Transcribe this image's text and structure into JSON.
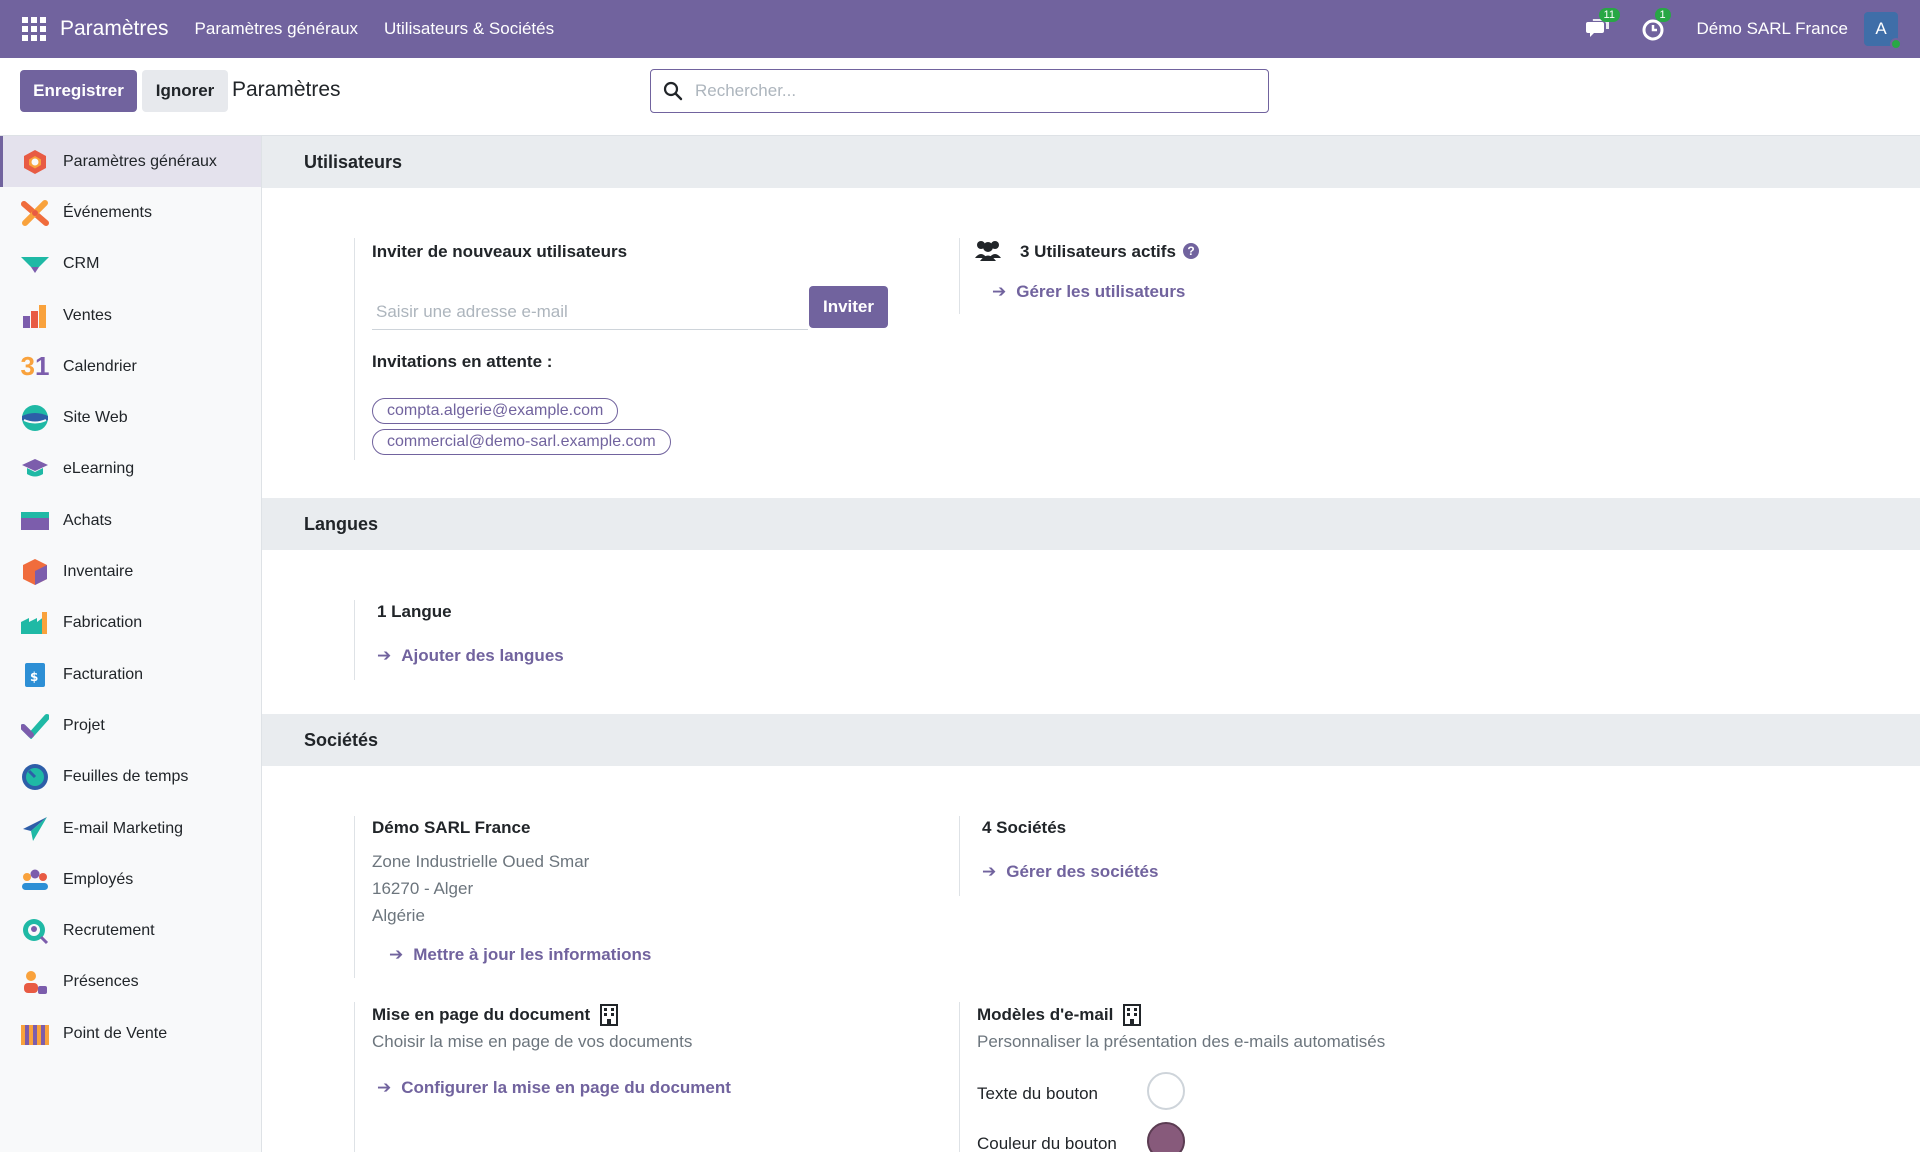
{
  "topbar": {
    "brand": "Paramètres",
    "menu": [
      "Paramètres généraux",
      "Utilisateurs & Sociétés"
    ],
    "messages_count": "11",
    "activities_count": "1",
    "company": "Démo SARL France",
    "avatar_letter": "A"
  },
  "control": {
    "save_label": "Enregistrer",
    "discard_label": "Ignorer",
    "title": "Paramètres",
    "search_placeholder": "Rechercher..."
  },
  "sidebar": {
    "items": [
      {
        "label": "Paramètres généraux",
        "icon": "settings-app-icon",
        "active": true
      },
      {
        "label": "Événements",
        "icon": "events-app-icon"
      },
      {
        "label": "CRM",
        "icon": "crm-app-icon"
      },
      {
        "label": "Ventes",
        "icon": "sales-app-icon"
      },
      {
        "label": "Calendrier",
        "icon": "calendar-app-icon"
      },
      {
        "label": "Site Web",
        "icon": "website-app-icon"
      },
      {
        "label": "eLearning",
        "icon": "elearning-app-icon"
      },
      {
        "label": "Achats",
        "icon": "purchase-app-icon"
      },
      {
        "label": "Inventaire",
        "icon": "inventory-app-icon"
      },
      {
        "label": "Fabrication",
        "icon": "manufacturing-app-icon"
      },
      {
        "label": "Facturation",
        "icon": "invoicing-app-icon"
      },
      {
        "label": "Projet",
        "icon": "project-app-icon"
      },
      {
        "label": "Feuilles de temps",
        "icon": "timesheets-app-icon"
      },
      {
        "label": "E-mail Marketing",
        "icon": "email-marketing-app-icon"
      },
      {
        "label": "Employés",
        "icon": "employees-app-icon"
      },
      {
        "label": "Recrutement",
        "icon": "recruitment-app-icon"
      },
      {
        "label": "Présences",
        "icon": "attendances-app-icon"
      },
      {
        "label": "Point de Vente",
        "icon": "pos-app-icon"
      }
    ]
  },
  "users": {
    "section_title": "Utilisateurs",
    "invite_title": "Inviter de nouveaux utilisateurs",
    "email_placeholder": "Saisir une adresse e-mail",
    "invite_button": "Inviter",
    "pending_title": "Invitations en attente :",
    "pending": [
      "compta.algerie@example.com",
      "commercial@demo-sarl.example.com"
    ],
    "active_users": "3 Utilisateurs actifs",
    "manage_users": "Gérer les utilisateurs"
  },
  "languages": {
    "section_title": "Langues",
    "count": "1 Langue",
    "add_link": "Ajouter des langues"
  },
  "companies": {
    "section_title": "Sociétés",
    "company_name": "Démo SARL France",
    "address_line1": "Zone Industrielle Oued Smar",
    "address_line2": "16270 - Alger",
    "address_line3": "Algérie",
    "update_link": "Mettre à jour les informations",
    "count": "4 Sociétés",
    "manage_link": "Gérer des sociétés",
    "layout_title": "Mise en page du document",
    "layout_desc": "Choisir la mise en page de vos documents",
    "layout_link": "Configurer la mise en page du document",
    "email_templates_title": "Modèles d'e-mail",
    "email_templates_desc": "Personnaliser la présentation des e-mails automatisés",
    "button_text_label": "Texte du bouton",
    "button_color_label": "Couleur du bouton",
    "button_text_color": "#ffffff",
    "button_color": "#875a7b"
  },
  "colors": {
    "brand": "#71639e",
    "success": "#28a745"
  }
}
